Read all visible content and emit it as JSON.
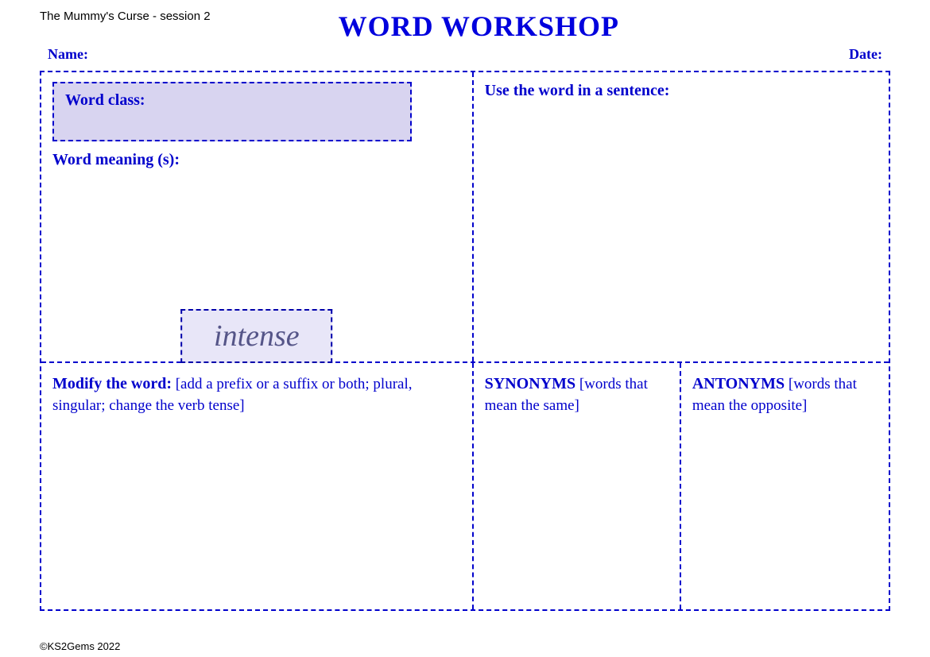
{
  "header": {
    "session_label": "The Mummy's Curse - session 2",
    "main_title": "WORD WORKSHOP"
  },
  "name_date": {
    "name_label": "Name:",
    "date_label": "Date:"
  },
  "left_panel": {
    "word_class_label": "Word class:",
    "word_meaning_label": "Word meaning (s):"
  },
  "right_panel": {
    "use_word_label": "Use the word in a sentence:"
  },
  "center_word": {
    "word": "intense"
  },
  "bottom_panels": {
    "modify_bold": "Modify the word:",
    "modify_rest": " [add a prefix or a suffix or both; plural, singular; change the verb tense]",
    "synonyms_bold": "SYNONYMS",
    "synonyms_rest": " [words that mean the same]",
    "antonyms_bold": "ANTONYMS",
    "antonyms_rest": " [words that mean the opposite]"
  },
  "footer": {
    "copyright": "©KS2Gems 2022"
  }
}
